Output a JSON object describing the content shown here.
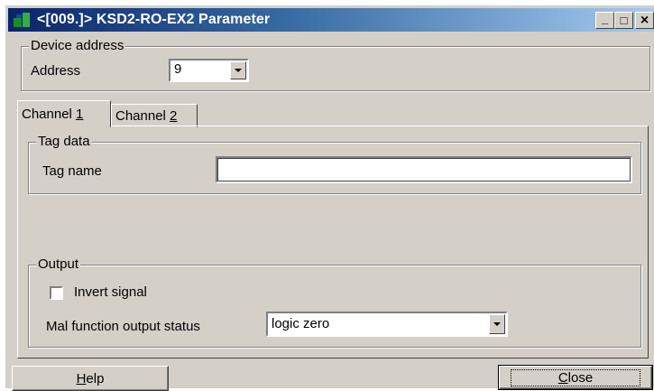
{
  "window": {
    "title": "<[009.]> KSD2-RO-EX2 Parameter",
    "minimize_glyph": "_",
    "maximize_glyph": "□",
    "close_glyph": "×"
  },
  "device_address": {
    "group_label": "Device address",
    "address_label": "Address",
    "address_value": "9"
  },
  "tabs": [
    {
      "label_prefix": "Channel ",
      "mnemonic": "1",
      "active": true
    },
    {
      "label_prefix": "Channel ",
      "mnemonic": "2",
      "active": false
    }
  ],
  "tag_data": {
    "group_label": "Tag data",
    "tag_name_label": "Tag name",
    "tag_name_value": ""
  },
  "output": {
    "group_label": "Output",
    "invert_signal_label": "Invert signal",
    "invert_signal_checked": false,
    "malfunction_label": "Mal function output status",
    "malfunction_value": "logic zero"
  },
  "buttons": {
    "help_mnemonic": "H",
    "help_rest": "elp",
    "close_mnemonic": "C",
    "close_rest": "lose"
  }
}
